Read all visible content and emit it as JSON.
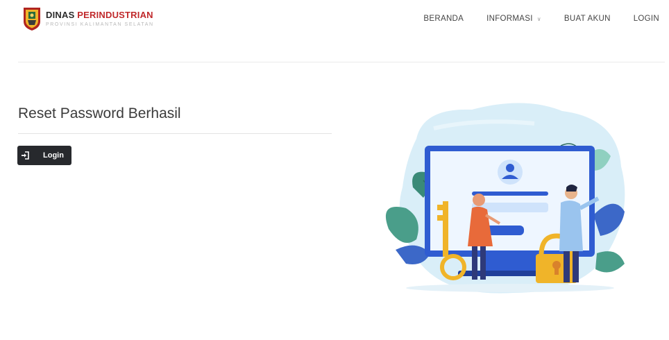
{
  "brand": {
    "title_part1": "DINAS",
    "title_part2": "PERINDUSTRIAN",
    "subtitle": "PROVINSI KALIMANTAN SELATAN"
  },
  "nav": {
    "items": [
      {
        "label": "BERANDA",
        "has_dropdown": false
      },
      {
        "label": "INFORMASI",
        "has_dropdown": true
      },
      {
        "label": "BUAT AKUN",
        "has_dropdown": false
      },
      {
        "label": "LOGIN",
        "has_dropdown": false
      }
    ]
  },
  "main": {
    "title": "Reset Password Berhasil",
    "login_button": {
      "label": "Login",
      "icon": "sign-in-icon"
    }
  },
  "colors": {
    "brand_red": "#c0292b",
    "button_dark": "#27292d",
    "illustration_blue": "#2f5cd1"
  }
}
